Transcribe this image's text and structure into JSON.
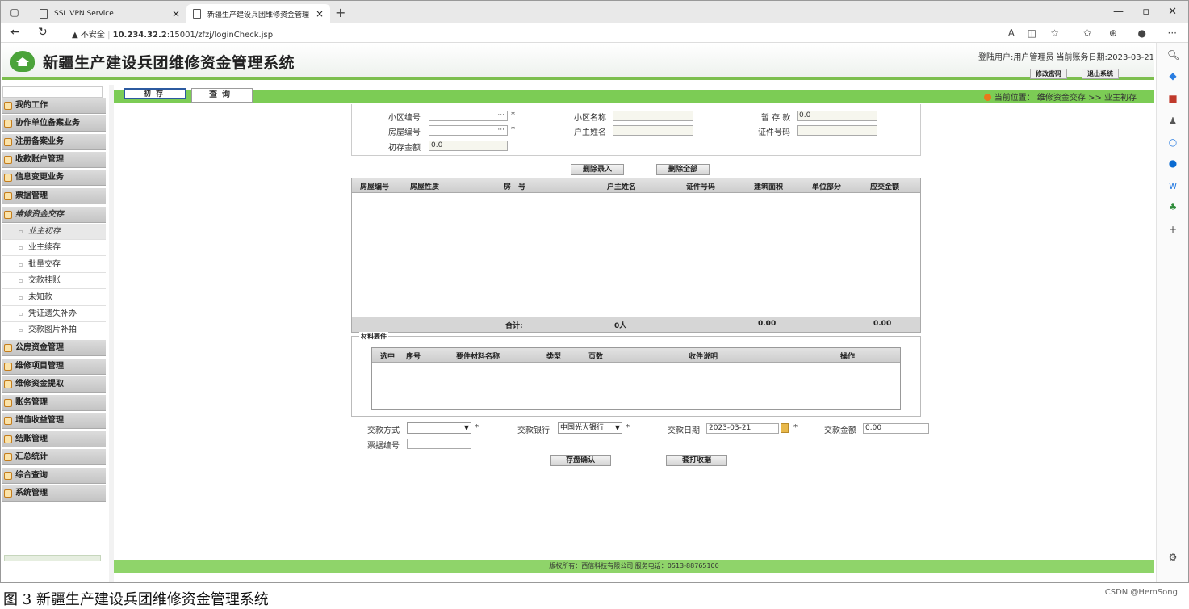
{
  "browser": {
    "tabs": [
      {
        "label": "SSL VPN Service"
      },
      {
        "label": "新疆生产建设兵团维修资金管理"
      }
    ],
    "url_warning": "不安全",
    "url_host": "10.234.32.2",
    "url_rest": ":15001/zfzj/loginCheck.jsp"
  },
  "app": {
    "title": "新疆生产建设兵团维修资金管理系统",
    "user_info": "登陆用户:用户管理员 当前账务日期:2023-03-21",
    "change_password": "修改密码",
    "logout": "退出系统",
    "tabs": [
      {
        "label": "初存"
      },
      {
        "label": "查询"
      }
    ],
    "breadcrumb": "当前位置：  维修资金交存 >>  业主初存",
    "footer": "版权所有：西信科技有限公司 服务电话：0513-88765100"
  },
  "nav": {
    "sections_top": [
      {
        "label": "我的工作"
      },
      {
        "label": "协作单位备案业务"
      },
      {
        "label": "注册备案业务"
      },
      {
        "label": "收款账户管理"
      },
      {
        "label": "信息变更业务"
      },
      {
        "label": "票据管理"
      },
      {
        "label": "维修资金交存"
      }
    ],
    "subitems": [
      {
        "label": "业主初存"
      },
      {
        "label": "业主续存"
      },
      {
        "label": "批量交存"
      },
      {
        "label": "交款挂账"
      },
      {
        "label": "未知款"
      },
      {
        "label": "凭证遗失补办"
      },
      {
        "label": "交款图片补拍"
      }
    ],
    "sections_bottom": [
      {
        "label": "公房资金管理"
      },
      {
        "label": "维修项目管理"
      },
      {
        "label": "维修资金提取"
      },
      {
        "label": "账务管理"
      },
      {
        "label": "增值收益管理"
      },
      {
        "label": "结账管理"
      },
      {
        "label": "汇总统计"
      },
      {
        "label": "综合查询"
      },
      {
        "label": "系统管理"
      }
    ]
  },
  "form": {
    "community_code_label": "小区编号",
    "community_code_value": "···",
    "community_name_label": "小区名称",
    "temp_amount_label": "暂 存 款",
    "temp_amount_value": "0.0",
    "house_code_label": "房屋编号",
    "house_code_value": "···",
    "owner_name_label": "户主姓名",
    "id_number_label": "证件号码",
    "initial_amount_label": "初存金额",
    "initial_amount_value": "0.0",
    "required_mark": "*",
    "delete_entry": "删除录入",
    "delete_all": "删除全部"
  },
  "grid1": {
    "headers": [
      "房屋编号",
      "房屋性质",
      "房　号",
      "户主姓名",
      "证件号码",
      "建筑面积",
      "单位部分",
      "应交金额"
    ],
    "footer_label": "合计:",
    "footer_count": "0人",
    "footer_area": "0.00",
    "footer_amount": "0.00"
  },
  "materials": {
    "legend": "材料要件",
    "headers": [
      "选中",
      "序号",
      "要件材料名称",
      "类型",
      "页数",
      "收件说明",
      "操作"
    ]
  },
  "payment": {
    "method_label": "交款方式",
    "bank_label": "交款银行",
    "bank_value": "中国光大银行",
    "date_label": "交款日期",
    "date_value": "2023-03-21",
    "amount_label": "交款金额",
    "amount_value": "0.00",
    "ticket_label": "票据编号",
    "confirm": "存盘确认",
    "print": "套打收据"
  },
  "caption": "图 3 新疆生产建设兵团维修资金管理系统",
  "watermark": "CSDN @HemSong"
}
